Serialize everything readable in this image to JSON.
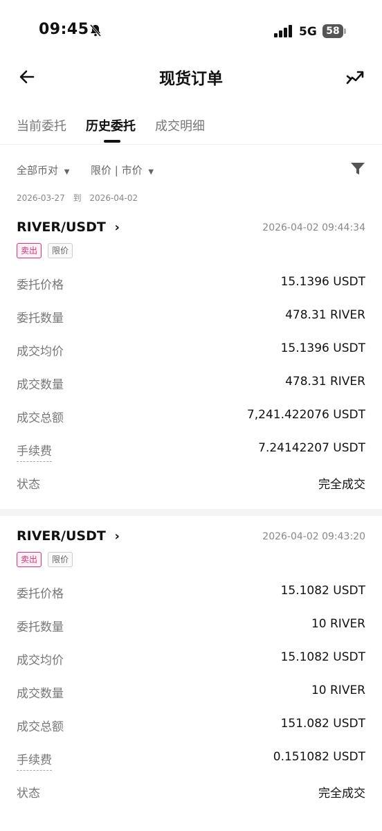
{
  "status_bar": {
    "time": "09:45",
    "network": "5G",
    "battery": "58"
  },
  "header": {
    "title": "现货订单"
  },
  "tabs": [
    {
      "label": "当前委托"
    },
    {
      "label": "历史委托"
    },
    {
      "label": "成交明细"
    }
  ],
  "filters": {
    "pair_filter": "全部币对",
    "type_filter": "限价 | 市价"
  },
  "date_range": {
    "from": "2026-03-27",
    "sep": "到",
    "to": "2026-04-02"
  },
  "orders": [
    {
      "pair": "RIVER/USDT",
      "time": "2026-04-02 09:44:34",
      "side": "卖出",
      "type": "限价",
      "rows": [
        {
          "label": "委托价格",
          "value": "15.1396 USDT"
        },
        {
          "label": "委托数量",
          "value": "478.31 RIVER"
        },
        {
          "label": "成交均价",
          "value": "15.1396 USDT"
        },
        {
          "label": "成交数量",
          "value": "478.31 RIVER"
        },
        {
          "label": "成交总额",
          "value": "7,241.422076 USDT"
        },
        {
          "label": "手续费",
          "value": "7.24142207 USDT"
        },
        {
          "label": "状态",
          "value": "完全成交"
        }
      ]
    },
    {
      "pair": "RIVER/USDT",
      "time": "2026-04-02 09:43:20",
      "side": "卖出",
      "type": "限价",
      "rows": [
        {
          "label": "委托价格",
          "value": "15.1082 USDT"
        },
        {
          "label": "委托数量",
          "value": "10 RIVER"
        },
        {
          "label": "成交均价",
          "value": "15.1082 USDT"
        },
        {
          "label": "成交数量",
          "value": "10 RIVER"
        },
        {
          "label": "成交总额",
          "value": "151.082 USDT"
        },
        {
          "label": "手续费",
          "value": "0.151082 USDT"
        },
        {
          "label": "状态",
          "value": "完全成交"
        }
      ]
    }
  ]
}
